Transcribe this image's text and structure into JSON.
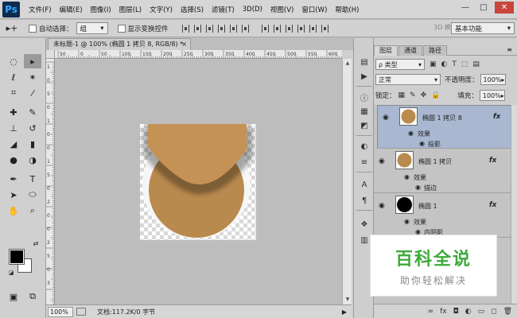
{
  "app": {
    "logo": "Ps"
  },
  "menu": [
    "文件(F)",
    "编辑(E)",
    "图像(I)",
    "图层(L)",
    "文字(Y)",
    "选择(S)",
    "滤镜(T)",
    "3D(D)",
    "视图(V)",
    "窗口(W)",
    "帮助(H)"
  ],
  "window": {
    "minimize": "—",
    "restore": "□",
    "close": "✕"
  },
  "options": {
    "tool_glyph": "▸+",
    "auto_select_label": "自动选择：",
    "auto_select_value": "组",
    "show_transform_label": "显示变换控件",
    "mode_3d": "3D 模式：",
    "workspace": "基本功能"
  },
  "document": {
    "tab_title": "未标题-1 @ 100% (椭圆 1 拷贝 8, RGB/8) *",
    "tab_close": "×",
    "zoom": "100%",
    "doc_size": "文档:117.2K/0 字节",
    "ruler_h": [
      "50",
      "0",
      "50",
      "100",
      "150",
      "200",
      "250",
      "300",
      "350",
      "400",
      "450",
      "500",
      "550",
      "600"
    ],
    "ruler_v": [
      "1",
      "0",
      "5",
      "0",
      "1",
      "0",
      "0",
      "1",
      "5",
      "0",
      "2",
      "0",
      "0",
      "2",
      "5",
      "0",
      "3"
    ]
  },
  "colors": {
    "fg": "#000000",
    "bg": "#ffffff",
    "shape": "#b98a4e",
    "shape_top": "#c49255",
    "selected_layer": "#a9b7d1"
  },
  "layers_panel": {
    "tabs": [
      "图层",
      "通道",
      "路径"
    ],
    "filter_label": "ρ 类型",
    "blend_mode": "正常",
    "opacity_label": "不透明度：",
    "opacity_value": "100%",
    "lock_label": "锁定：",
    "fill_label": "填充：",
    "fill_value": "100%",
    "layers": [
      {
        "name": "椭圆 1 拷贝 8",
        "fx": "fx",
        "effects_label": "效果",
        "effect": "投影",
        "selected": true
      },
      {
        "name": "椭圆 1 拷贝",
        "fx": "fx",
        "effects_label": "效果",
        "effect": "描边",
        "selected": false
      },
      {
        "name": "椭圆 1",
        "fx": "fx",
        "effects_label": "效果",
        "effect": "内阴影",
        "selected": false
      }
    ]
  },
  "watermark": {
    "title": "百科全说",
    "subtitle": "助你轻松解决"
  }
}
